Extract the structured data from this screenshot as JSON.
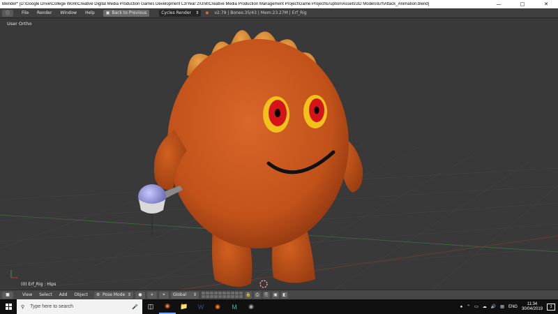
{
  "window": {
    "title": "Blender* [D:\\Google Drive\\College Work\\Creative Digital Media Production Games Development L3\\Year 2\\Unit\\Creative Media Production Management Project\\Game Project\\Eruption\\Assets\\3D Models\\Erf\\Attack_Animation.blend]",
    "minimize_icon": "minimize-icon",
    "maximize_icon": "maximize-icon",
    "close_icon": "close-icon"
  },
  "info_header": {
    "menu": [
      "File",
      "Render",
      "Window",
      "Help"
    ],
    "back_button": "Back to Previous",
    "render_engine": "Cycles Render",
    "stats": "v2.79 | Bones:35/43 | Mem:23.27M | Erf_Rig"
  },
  "viewport": {
    "view_label": "User Ortho",
    "object_label": "(0) Erf_Rig : Hips"
  },
  "viewport_header": {
    "menu": [
      "View",
      "Select",
      "Add",
      "Object"
    ],
    "mode": "Pose Mode",
    "orientation": "Global"
  },
  "taskbar": {
    "search_placeholder": "Type here to search",
    "language": "ENG",
    "time": "11:34",
    "date": "30/04/2019",
    "notification_count": "3",
    "apps": [
      "task-view-icon",
      "blender-icon",
      "file-explorer-icon",
      "word-icon",
      "firefox-icon",
      "maya-icon",
      "blender-app-icon"
    ]
  },
  "colors": {
    "viewport_bg": "#393939",
    "character_orange": "#c8561a",
    "eye_yellow": "#f2c21a",
    "eye_red": "#d4141a"
  }
}
